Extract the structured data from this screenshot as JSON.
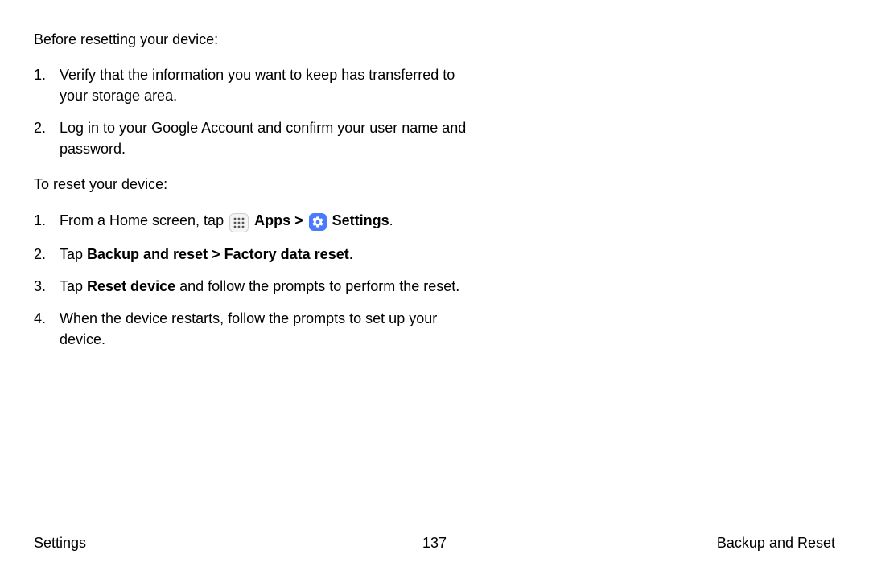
{
  "intro1": "Before resetting your device:",
  "pre_steps": [
    "Verify that the information you want to keep has transferred to your storage area.",
    "Log in to your Google Account and confirm your user name and password."
  ],
  "intro2": "To reset your device:",
  "reset_steps": {
    "s1": {
      "lead": "From a Home screen, tap ",
      "apps_label": "Apps",
      "chevron": ">",
      "settings_label": "Settings",
      "tail": "."
    },
    "s2": {
      "lead": "Tap ",
      "bold1": "Backup and reset",
      "chevron": ">",
      "bold2": "Factory data reset",
      "tail": "."
    },
    "s3": {
      "lead": "Tap ",
      "bold": "Reset device",
      "rest": " and follow the prompts to perform the reset."
    },
    "s4": "When the device restarts, follow the prompts to set up your device."
  },
  "footer": {
    "left": "Settings",
    "center": "137",
    "right": "Backup and Reset"
  }
}
